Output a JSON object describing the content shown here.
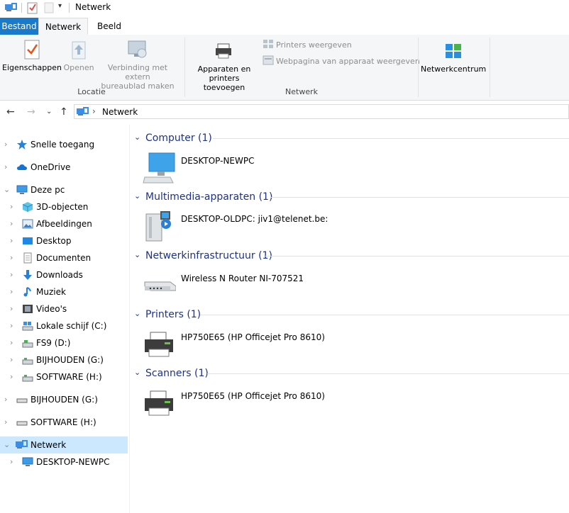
{
  "window": {
    "title": "Netwerk"
  },
  "tabs": [
    {
      "label": "Bestand"
    },
    {
      "label": "Netwerk"
    },
    {
      "label": "Beeld"
    }
  ],
  "ribbon": {
    "locatie": {
      "label": "Locatie",
      "eigenschappen": "Eigenschappen",
      "openen": "Openen",
      "verbinding_line1": "Verbinding met extern",
      "verbinding_line2": "bureaublad maken"
    },
    "netwerk": {
      "label": "Netwerk",
      "apparaten_line1": "Apparaten en",
      "apparaten_line2": "printers toevoegen",
      "printers_weergeven": "Printers weergeven",
      "webpagina": "Webpagina van apparaat weergeven"
    },
    "netwerkcentrum": "Netwerkcentrum"
  },
  "address": {
    "crumb_sep": "›",
    "location": "Netwerk"
  },
  "sidebar": {
    "items": [
      {
        "label": "Snelle toegang",
        "icon": "star-icon"
      },
      {
        "label": "OneDrive",
        "icon": "cloud-icon"
      },
      {
        "label": "Deze pc",
        "icon": "computer-icon"
      },
      {
        "label": "3D-objecten",
        "icon": "cube-icon"
      },
      {
        "label": "Afbeeldingen",
        "icon": "pictures-icon"
      },
      {
        "label": "Desktop",
        "icon": "desktop-icon"
      },
      {
        "label": "Documenten",
        "icon": "documents-icon"
      },
      {
        "label": "Downloads",
        "icon": "download-icon"
      },
      {
        "label": "Muziek",
        "icon": "music-icon"
      },
      {
        "label": "Video's",
        "icon": "video-icon"
      },
      {
        "label": "Lokale schijf (C:)",
        "icon": "drive-icon"
      },
      {
        "label": "FS9 (D:)",
        "icon": "drive-icon"
      },
      {
        "label": "BIJHOUDEN (G:)",
        "icon": "drive-icon"
      },
      {
        "label": "SOFTWARE (H:)",
        "icon": "drive-icon"
      },
      {
        "label": "BIJHOUDEN (G:)",
        "icon": "drive-icon"
      },
      {
        "label": "SOFTWARE (H:)",
        "icon": "drive-icon"
      },
      {
        "label": "Netwerk",
        "icon": "network-icon"
      },
      {
        "label": "DESKTOP-NEWPC",
        "icon": "computer-icon"
      }
    ]
  },
  "groups": [
    {
      "title": "Computer (1)",
      "items": [
        {
          "label": "DESKTOP-NEWPC",
          "icon": "computer-icon"
        }
      ]
    },
    {
      "title": "Multimedia-apparaten (1)",
      "items": [
        {
          "label": "DESKTOP-OLDPC: jiv1@telenet.be:",
          "icon": "media-device-icon"
        }
      ]
    },
    {
      "title": "Netwerkinfrastructuur (1)",
      "items": [
        {
          "label": "Wireless N Router NI-707521",
          "icon": "router-icon"
        }
      ]
    },
    {
      "title": "Printers (1)",
      "items": [
        {
          "label": "HP750E65 (HP Officejet Pro 8610)",
          "icon": "printer-icon"
        }
      ]
    },
    {
      "title": "Scanners (1)",
      "items": [
        {
          "label": "HP750E65 (HP Officejet Pro 8610)",
          "icon": "printer-icon"
        }
      ]
    }
  ],
  "colors": {
    "accent": "#1979ca",
    "group_heading": "#1e3287",
    "selection": "#cce8ff"
  }
}
